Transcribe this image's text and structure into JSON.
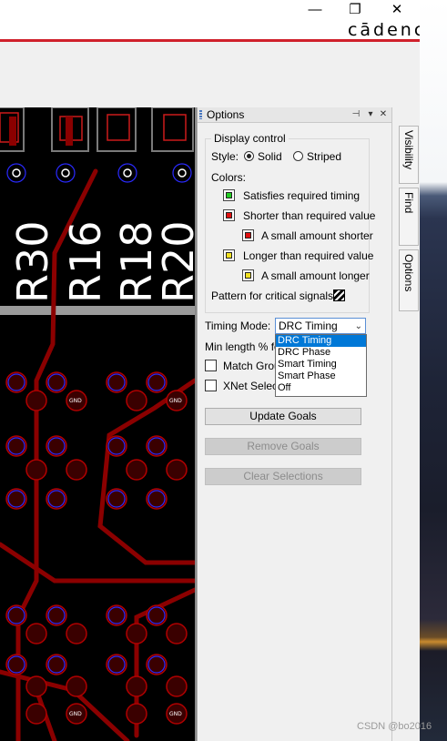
{
  "window": {
    "brand": "cādence",
    "brand_color": "#d0202b",
    "buttons": [
      "minimize-icon",
      "restore-icon",
      "close-icon"
    ],
    "minimize_glyph": "—",
    "restore_glyph": "❐",
    "close_glyph": "✕"
  },
  "pcb": {
    "designators": [
      "R30",
      "R16",
      "R18",
      "R20"
    ],
    "pad_label": "GND",
    "trace_color": "#8b0000",
    "via_ring_color": "#2020ff"
  },
  "panel": {
    "title": "Options",
    "header_icons": [
      "pin-icon",
      "dropdown-icon",
      "close-icon"
    ],
    "pin_glyph": "⊣",
    "menu_glyph": "▾",
    "close_glyph": "✕",
    "display_control": {
      "legend": "Display control",
      "style_label": "Style:",
      "style_options": [
        "Solid",
        "Striped"
      ],
      "style_selected": "Solid",
      "colors_label": "Colors:",
      "color_items": [
        {
          "label": "Satisfies required timing",
          "color": "#22cc22"
        },
        {
          "label": "Shorter than required value",
          "color": "#e01010"
        },
        {
          "label": "A small amount shorter",
          "color": "#e01010"
        },
        {
          "label": "Longer than required value",
          "color": "#f0e020"
        },
        {
          "label": "A small amount longer",
          "color": "#f0e020"
        }
      ],
      "pattern_label": "Pattern for critical signals:"
    },
    "timing_mode": {
      "label": "Timing Mode:",
      "value": "DRC Timing",
      "options": [
        "DRC Timing",
        "DRC Phase",
        "Smart Timing",
        "Smart Phase",
        "Off"
      ]
    },
    "min_length_label": "Min length % for",
    "checkboxes": [
      "Match Grou",
      "XNet Select"
    ],
    "buttons": {
      "update_goals": "Update Goals",
      "remove_goals": "Remove Goals",
      "clear_selections": "Clear Selections"
    }
  },
  "side_tabs": [
    "Visibility",
    "Find",
    "Options"
  ],
  "watermark": "CSDN @bo2016"
}
